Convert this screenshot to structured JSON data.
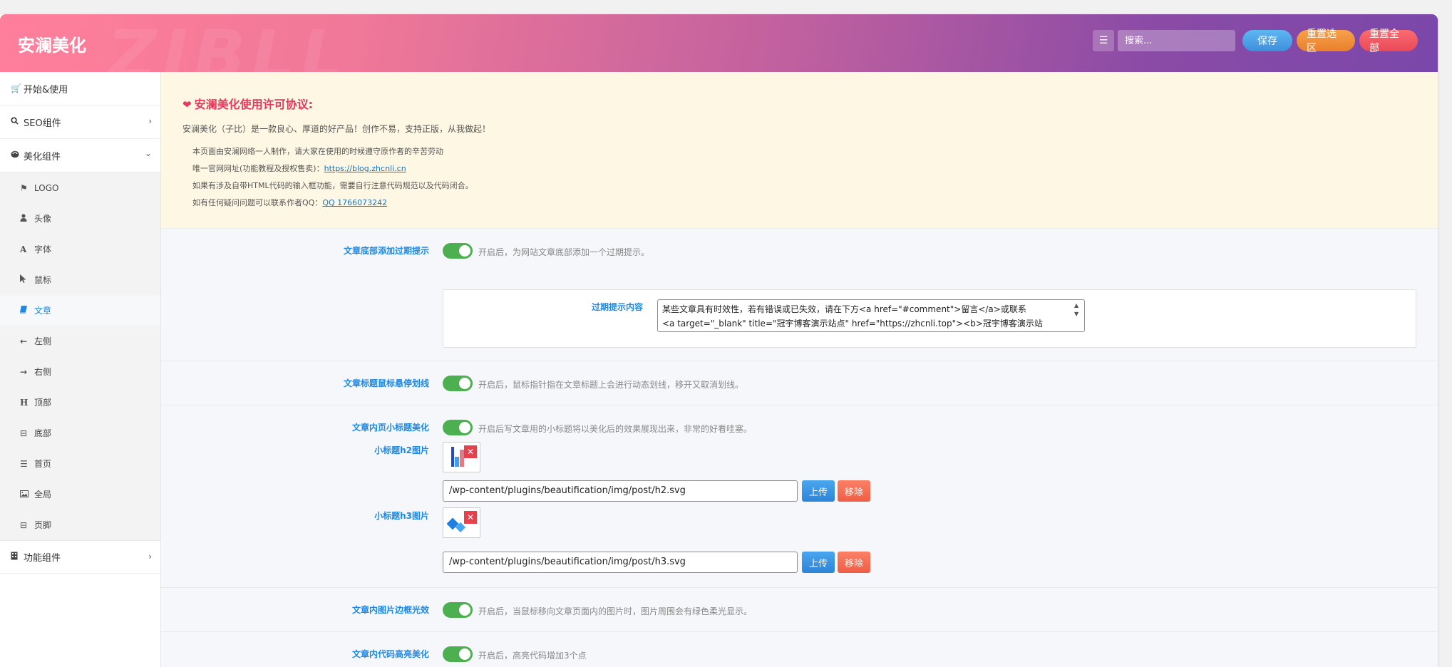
{
  "header": {
    "brand": "安澜美化",
    "watermark": "ZIBLL",
    "search_placeholder": "搜索...",
    "save_label": "保存",
    "reset_section_label": "重置选区",
    "reset_all_label": "重置全部"
  },
  "sidebar": {
    "top_items": [
      {
        "label": "开始&使用",
        "icon": "cart-icon"
      },
      {
        "label": "SEO组件",
        "icon": "search-icon"
      },
      {
        "label": "美化组件",
        "icon": "palette-icon"
      }
    ],
    "sub_items": [
      {
        "label": "LOGO",
        "icon": "flag-icon"
      },
      {
        "label": "头像",
        "icon": "user-icon"
      },
      {
        "label": "字体",
        "icon": "font-icon"
      },
      {
        "label": "鼠标",
        "icon": "cursor-icon"
      },
      {
        "label": "文章",
        "icon": "book-icon"
      },
      {
        "label": "左侧",
        "icon": "arrow-left-icon"
      },
      {
        "label": "右侧",
        "icon": "arrow-right-icon"
      },
      {
        "label": "顶部",
        "icon": "heading-icon"
      },
      {
        "label": "底部",
        "icon": "square-minus-icon"
      },
      {
        "label": "首页",
        "icon": "list-icon"
      },
      {
        "label": "全局",
        "icon": "image-icon"
      },
      {
        "label": "页脚",
        "icon": "square-minus-icon"
      }
    ],
    "bottom_item": {
      "label": "功能组件",
      "icon": "building-icon"
    }
  },
  "license": {
    "title": "安澜美化使用许可协议:",
    "intro": "安澜美化（子比）是一款良心、厚道的好产品！创作不易，支持正版，从我做起！",
    "line1": "本页面由安澜网络一人制作，请大家在使用的时候遵守原作者的辛苦劳动",
    "line2_prefix": "唯一官网网址(功能教程及授权售卖)：",
    "line2_link": "https://blog.zhcnli.cn",
    "line3": "如果有涉及自带HTML代码的输入框功能，需要自行注意代码规范以及代码闭合。",
    "line4_prefix": "如有任何疑问问题可以联系作者QQ：",
    "line4_link": "QQ 1766073242"
  },
  "settings": {
    "expire": {
      "label": "文章底部添加过期提示",
      "desc": "开启后，为网站文章底部添加一个过期提示。",
      "sub_label": "过期提示内容",
      "sub_value": "某些文章具有时效性，若有错误或已失效，请在下方<a href=\"#comment\">留言</a>或联系\n<a target=\"_blank\" title=\"冠宇博客演示站点\" href=\"https://zhcnli.top\"><b>冠宇博客演示站"
    },
    "title_hover": {
      "label": "文章标题鼠标悬停划线",
      "desc": "开启后，鼠标指针指在文章标题上会进行动态划线，移开又取消划线。"
    },
    "subtitle": {
      "label": "文章内页小标题美化",
      "desc": "开启后写文章用的小标题将以美化后的效果展现出来，非常的好看哇塞。",
      "h2_label": "小标题h2图片",
      "h2_path": "/wp-content/plugins/beautification/img/post/h2.svg",
      "h3_label": "小标题h3图片",
      "h3_path": "/wp-content/plugins/beautification/img/post/h3.svg",
      "upload_label": "上传",
      "remove_label": "移除"
    },
    "img_glow": {
      "label": "文章内图片边框光效",
      "desc": "开启后，当鼠标移向文章页面内的图片时，图片周围会有绿色柔光显示。"
    },
    "code": {
      "label": "文章内代码高亮美化",
      "desc": "开启后，高亮代码增加3个点"
    }
  },
  "colors": {
    "accent": "#1e88e5",
    "toggle_on": "#4caf50",
    "license_bg": "#fdf7e3",
    "license_title": "#e8395c"
  }
}
